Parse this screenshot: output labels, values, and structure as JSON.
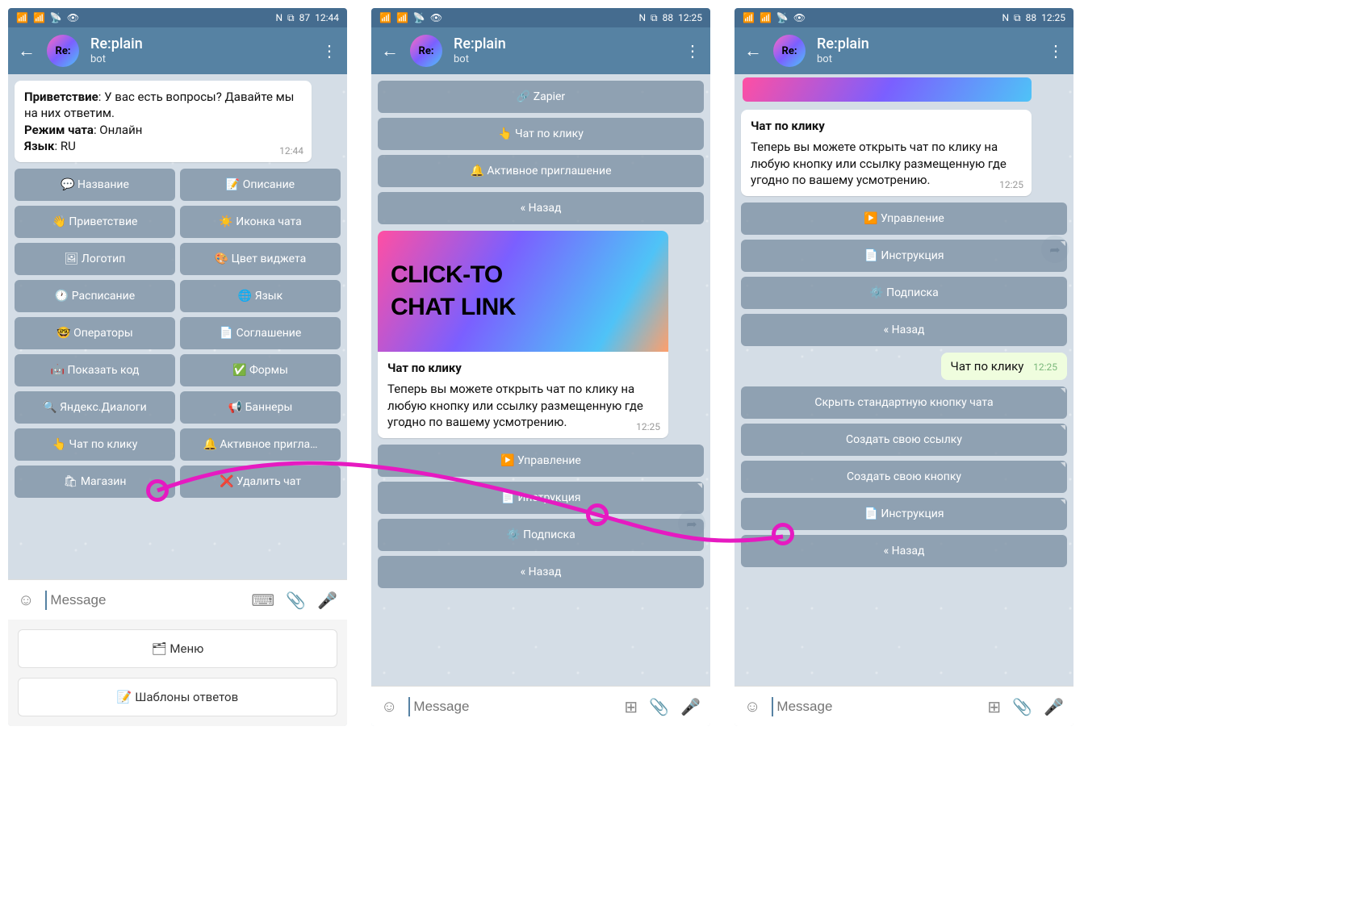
{
  "statusbar": {
    "nfc": "N",
    "bt": "⧉",
    "battery1": "87",
    "battery2": "88",
    "time1": "12:44",
    "time2": "12:25"
  },
  "header": {
    "title": "Re:plain",
    "subtitle": "bot",
    "avatar_text": "Re:"
  },
  "screen1": {
    "msg": {
      "greeting_label": "Приветствие",
      "greeting_text": ": У вас есть вопросы? Давайте мы на них ответим.",
      "mode_label": "Режим чата",
      "mode_text": ": Онлайн",
      "lang_label": "Язык",
      "lang_text": ": RU",
      "time": "12:44"
    },
    "buttons": [
      [
        "💬 Название",
        "📝 Описание"
      ],
      [
        "👋 Приветствие",
        "☀️ Иконка чата"
      ],
      [
        "🖼 Логотип",
        "🎨 Цвет виджета"
      ],
      [
        "🕐 Расписание",
        "🌐 Язык"
      ],
      [
        "🤓 Операторы",
        "📄 Соглашение"
      ],
      [
        "🤖 Показать код",
        "✅ Формы"
      ],
      [
        "🔍 Яндекс.Диалоги",
        "📢 Баннеры"
      ],
      [
        "👆 Чат по клику",
        "🔔 Активное пригла…"
      ],
      [
        "🛍 Магазин",
        "❌ Удалить чат"
      ]
    ],
    "input_placeholder": "Message",
    "kbd": [
      "🗂 Меню",
      "📝 Шаблоны ответов"
    ]
  },
  "screen2": {
    "top_buttons": [
      "🔗 Zapier",
      "👆 Чат по клику",
      "🔔 Активное приглашение",
      "« Назад"
    ],
    "card": {
      "img_line1": "CLICK-TO",
      "img_line2": "CHAT LINK",
      "title": "Чат по клику",
      "body": "Теперь вы можете открыть чат по клику на любую кнопку или ссылку размещенную где угодно по вашему усмотрению.",
      "time": "12:25"
    },
    "bottom_buttons": [
      "▶️ Управление",
      "📄 Инструкция",
      "⚙️ Подписка",
      "« Назад"
    ],
    "input_placeholder": "Message"
  },
  "screen3": {
    "card": {
      "title": "Чат по клику",
      "body": "Теперь вы можете открыть чат по клику на любую кнопку или ссылку размещенную где угодно по вашему усмотрению.",
      "time": "12:25"
    },
    "mid_buttons": [
      "▶️ Управление",
      "📄 Инструкция",
      "⚙️ Подписка",
      "« Назад"
    ],
    "outgoing": {
      "text": "Чат по клику",
      "time": "12:25"
    },
    "bottom_buttons": [
      "Скрыть стандартную кнопку чата",
      "Создать свою ссылку",
      "Создать свою кнопку",
      "📄 Инструкция",
      "« Назад"
    ],
    "input_placeholder": "Message"
  }
}
